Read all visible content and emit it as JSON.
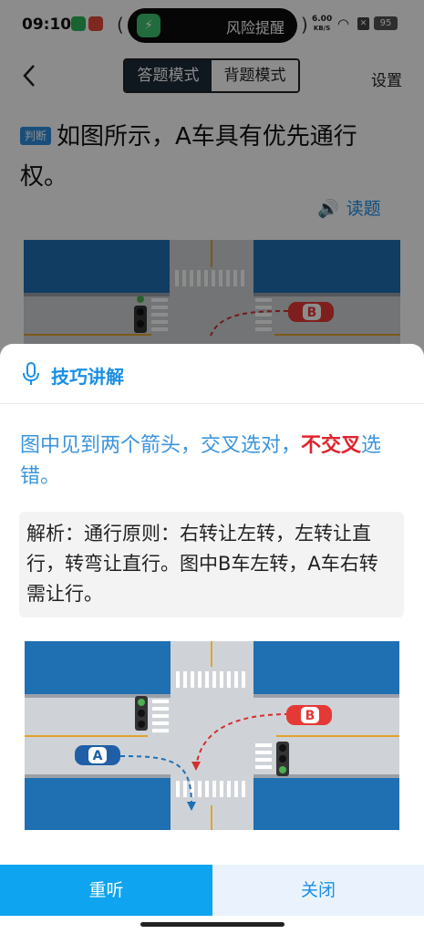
{
  "status_bar": {
    "time": "09:10",
    "alert_text": "风险提醒",
    "net_speed_value": "6.00",
    "net_speed_unit": "KB/S",
    "battery": "95"
  },
  "nav": {
    "mode_answer": "答题模式",
    "mode_memorize": "背题模式",
    "settings": "设置"
  },
  "question": {
    "tag": "判断",
    "text": "如图所示，A车具有优先通行权。",
    "read_label": "读题"
  },
  "diagram": {
    "car_a_label": "A",
    "car_b_label": "B"
  },
  "sheet": {
    "title": "技巧讲解",
    "tip_part1": "图中见到两个箭头，交叉选对，",
    "tip_highlight": "不交叉",
    "tip_part2": "选错。",
    "analysis": "解析：通行原则：右转让左转，左转让直行，转弯让直行。图中B车左转，A车右转需让行。",
    "relisten": "重听",
    "close": "关闭"
  },
  "colors": {
    "accent": "#1a8fe6",
    "highlight_red": "#e0232d",
    "road_block": "#1f6fb3",
    "relisten_bg": "#0fa4ef"
  }
}
